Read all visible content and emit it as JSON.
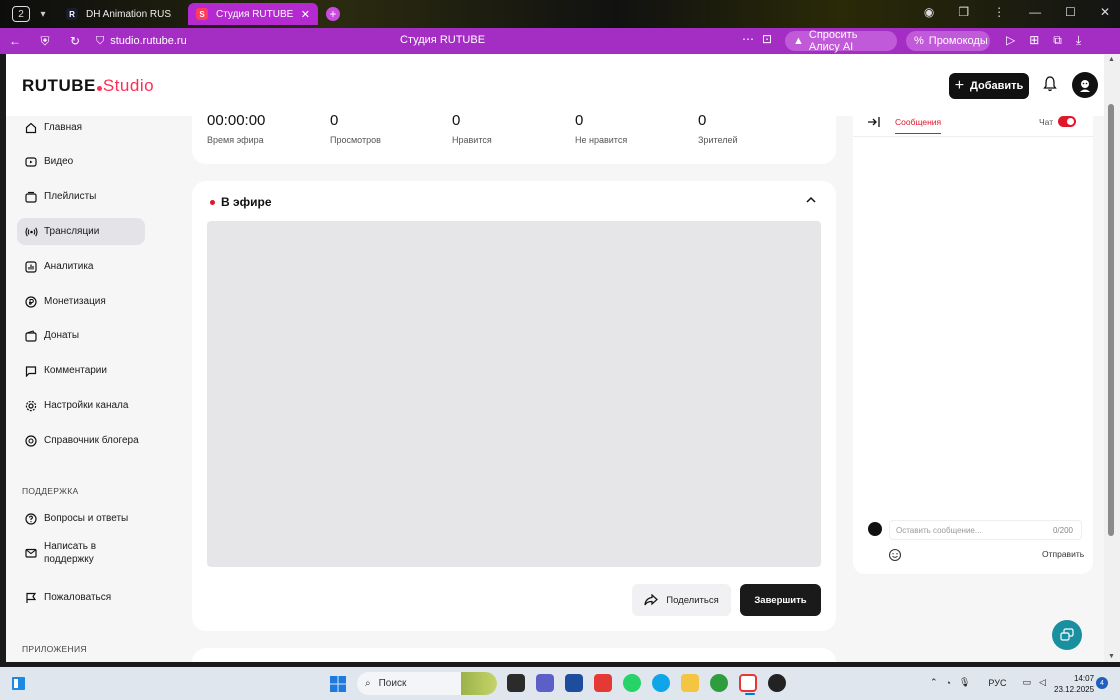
{
  "browser": {
    "tab_count": "2",
    "tabs": [
      {
        "label": "DH Animation RUS. Смотр",
        "favicon": "R"
      },
      {
        "label": "Студия RUTUBE",
        "favicon": "S"
      }
    ],
    "url": "studio.rutube.ru",
    "page_title": "Студия RUTUBE",
    "alice_label": "Спросить Алису AI",
    "promo_label": "Промокоды",
    "accent": "#a42ec4"
  },
  "header": {
    "logo_main": "RUTUBE",
    "logo_studio": "Studio",
    "add_label": "Добавить",
    "brand_color": "#ff2d55"
  },
  "sidebar": {
    "items": [
      {
        "label": "Главная",
        "icon": "home-icon"
      },
      {
        "label": "Видео",
        "icon": "video-icon"
      },
      {
        "label": "Плейлисты",
        "icon": "playlist-icon"
      },
      {
        "label": "Трансляции",
        "icon": "broadcast-icon",
        "active": true
      },
      {
        "label": "Аналитика",
        "icon": "analytics-icon"
      },
      {
        "label": "Монетизация",
        "icon": "ruble-icon"
      },
      {
        "label": "Донаты",
        "icon": "wallet-icon"
      },
      {
        "label": "Комментарии",
        "icon": "comment-icon"
      },
      {
        "label": "Настройки канала",
        "icon": "gear-icon"
      },
      {
        "label": "Справочник блогера",
        "icon": "help-circle-icon"
      }
    ],
    "support_title": "ПОДДЕРЖКА",
    "support_items": [
      {
        "label": "Вопросы и ответы",
        "icon": "question-icon"
      },
      {
        "label": "Написать в поддержку",
        "icon": "mail-icon"
      },
      {
        "label": "Пожаловаться",
        "icon": "flag-icon"
      }
    ],
    "apps_title": "ПРИЛОЖЕНИЯ"
  },
  "stats": [
    {
      "value": "00:00:00",
      "label": "Время эфира"
    },
    {
      "value": "0",
      "label": "Просмотров"
    },
    {
      "value": "0",
      "label": "Нравится"
    },
    {
      "value": "0",
      "label": "Не нравится"
    },
    {
      "value": "0",
      "label": "Зрителей"
    }
  ],
  "live": {
    "title": "В эфире",
    "share_label": "Поделиться",
    "finish_label": "Завершить"
  },
  "chat": {
    "tab_messages": "Сообщения",
    "chat_label": "Чат",
    "chat_enabled": true,
    "input_placeholder": "Оставить сообщение...",
    "counter": "0/200",
    "send_label": "Отправить"
  },
  "taskbar": {
    "search_label": "Поиск",
    "lang": "РУС",
    "time": "14:07",
    "date": "23.12.2025",
    "notifications": "4"
  }
}
